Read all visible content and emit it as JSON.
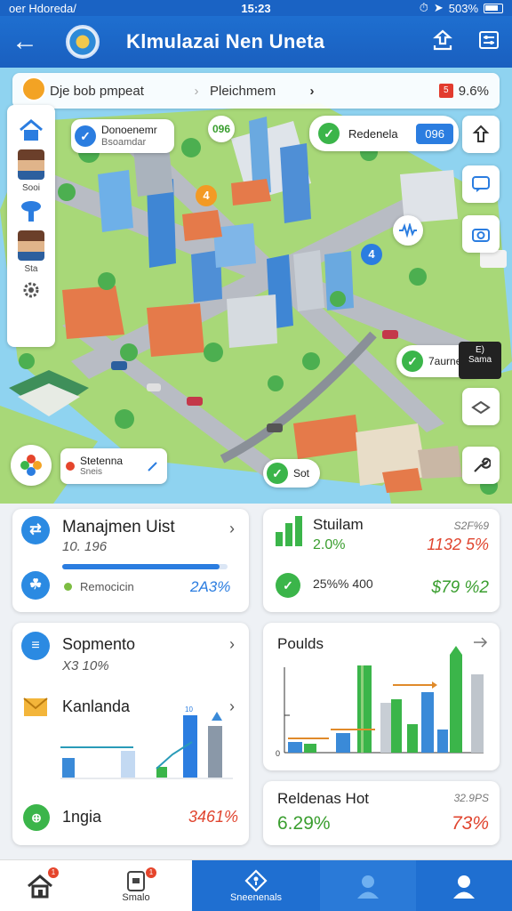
{
  "status_bar": {
    "carrier": "oer Hdoreda/",
    "time": "15:23",
    "battery": "503%"
  },
  "header": {
    "title": "Klmulazai Nen Uneta"
  },
  "map": {
    "search": {
      "query": "Dje bob pmpeat",
      "location": "Pleichmem",
      "percent": "9.6%"
    },
    "rail": [
      {
        "label": "Sooi"
      },
      {
        "label": "Sta"
      }
    ],
    "markers": {
      "info_card": {
        "title": "Donoenemr",
        "subtitle": "Bsoamdar"
      },
      "pill_96": "096",
      "status_pill": {
        "label": "Redenela",
        "value": "096"
      },
      "bubble_4a": "4",
      "bubble_4b": "4",
      "station_pill": {
        "label": "Stetenna",
        "sub": "Sneis"
      },
      "zone_pill": {
        "label": "7aurne",
        "tag_top": "E)",
        "tag_bottom": "Sama"
      },
      "bottom_pill": "Sot"
    }
  },
  "cards": {
    "manajemen": {
      "title": "Manajmen Uist",
      "sub": "10. 196",
      "progress": 0.95,
      "row_label": "Remocicin",
      "row_value": "2A3%"
    },
    "stuilam": {
      "title": "Stuilam",
      "corner": "S2F%9",
      "value1": "2.0%",
      "value2": "1132 5%",
      "row_value": "25%% 400",
      "row_value2": "$79 %2"
    },
    "sopmento": {
      "title": "Sopmento",
      "sub": "X3 10%"
    },
    "kanlanda": {
      "title": "Kanlanda",
      "badge": "10"
    },
    "ingsia": {
      "title": "1ngia",
      "value": "3461%"
    },
    "poulds": {
      "title": "Poulds",
      "ticks": [
        "0"
      ]
    },
    "reldenas": {
      "title": "Reldenas Hot",
      "corner": "32.9PS",
      "value1": "6.29%",
      "value2": "73%"
    }
  },
  "bottom_nav": [
    {
      "label": "",
      "icon": "home-icon",
      "badge": "1"
    },
    {
      "label": "Smalo",
      "icon": "clipboard-icon",
      "badge": "1"
    },
    {
      "label": "Sneenenals",
      "icon": "location-diamond-icon"
    },
    {
      "label": "",
      "icon": "person-icon"
    },
    {
      "label": "",
      "icon": "person-icon"
    }
  ],
  "colors": {
    "primary": "#1f6fd1",
    "green": "#3bb54a",
    "red": "#e0452f",
    "water": "#8fd3f0",
    "land": "#a8d878"
  }
}
